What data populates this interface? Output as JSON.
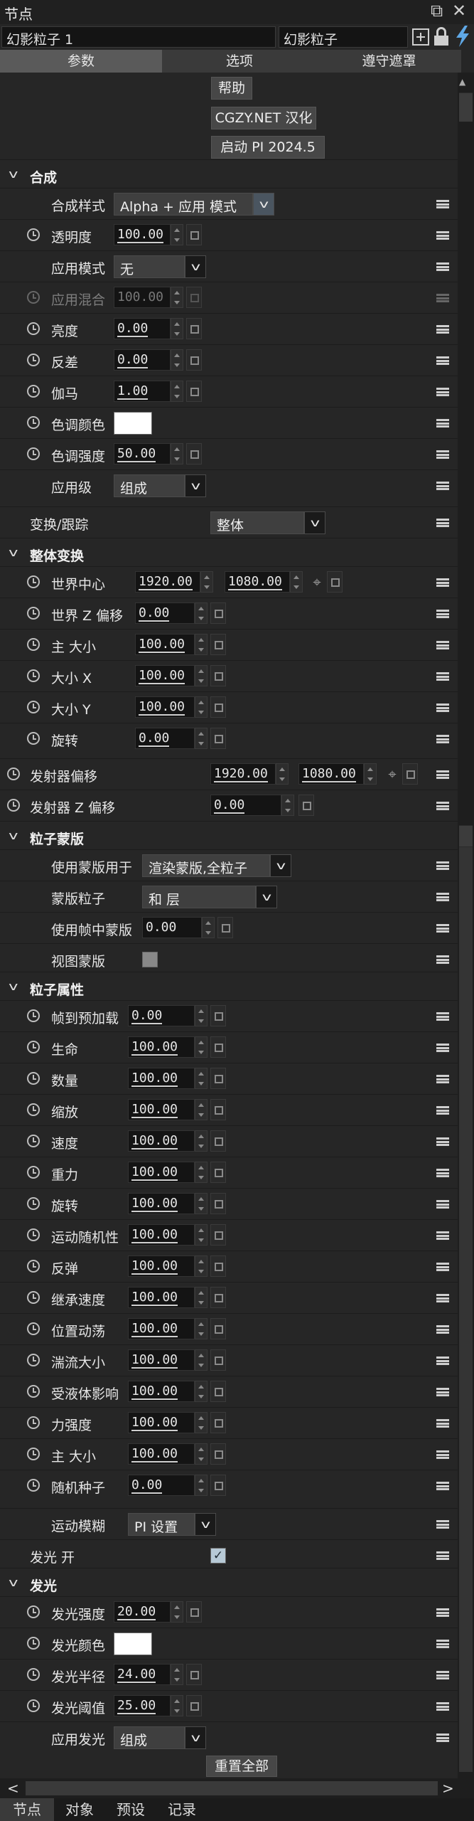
{
  "panel": {
    "title": "节点",
    "dock_icon": "⧉",
    "close_icon": "✕",
    "layer_name": "幻影粒子 1",
    "effect_name": "幻影粒子"
  },
  "tabs": [
    "参数",
    "选项",
    "遵守遮罩"
  ],
  "top_buttons": {
    "help": "帮助",
    "credit": "CGZY.NET 汉化",
    "launch": "启动 PI 2024.5"
  },
  "composite": {
    "header": "合成",
    "style_label": "合成样式",
    "style_value": "Alpha + 应用 模式",
    "opacity_label": "透明度",
    "opacity_value": "100.00",
    "apply_mode_label": "应用模式",
    "apply_mode_value": "无",
    "apply_blend_label": "应用混合",
    "apply_blend_value": "100.00",
    "brightness_label": "亮度",
    "brightness_value": "0.00",
    "contrast_label": "反差",
    "contrast_value": "0.00",
    "gamma_label": "伽马",
    "gamma_value": "1.00",
    "tint_color_label": "色调颜色",
    "tint_color": "#ffffff",
    "tint_strength_label": "色调强度",
    "tint_strength_value": "50.00",
    "apply_level_label": "应用级",
    "apply_level_value": "组成"
  },
  "transform_track": {
    "label": "变换/跟踪",
    "value": "整体"
  },
  "global_transform": {
    "header": "整体变换",
    "world_center_label": "世界中心",
    "world_center_x": "1920.00",
    "world_center_y": "1080.00",
    "world_z_label": "世界 Z 偏移",
    "world_z_value": "0.00",
    "master_size_label": "主 大小",
    "master_size_value": "100.00",
    "size_x_label": "大小 X",
    "size_x_value": "100.00",
    "size_y_label": "大小 Y",
    "size_y_value": "100.00",
    "rotation_label": "旋转",
    "rotation_value": "0.00"
  },
  "emitter": {
    "offset_label": "发射器偏移",
    "offset_x": "1920.00",
    "offset_y": "1080.00",
    "z_offset_label": "发射器 Z 偏移",
    "z_offset_value": "0.00"
  },
  "particle_mask": {
    "header": "粒子蒙版",
    "use_mask_label": "使用蒙版用于",
    "use_mask_value": "渲染蒙版,全粒子",
    "mask_particles_label": "蒙版粒子",
    "mask_particles_value": "和 层",
    "use_frame_mask_label": "使用帧中蒙版",
    "use_frame_mask_value": "0.00",
    "view_mask_label": "视图蒙版"
  },
  "particle_props": {
    "header": "粒子属性",
    "items": [
      {
        "label": "帧到预加载",
        "value": "0.00"
      },
      {
        "label": "生命",
        "value": "100.00"
      },
      {
        "label": "数量",
        "value": "100.00"
      },
      {
        "label": "缩放",
        "value": "100.00"
      },
      {
        "label": "速度",
        "value": "100.00"
      },
      {
        "label": "重力",
        "value": "100.00"
      },
      {
        "label": "旋转",
        "value": "100.00"
      },
      {
        "label": "运动随机性",
        "value": "100.00"
      },
      {
        "label": "反弹",
        "value": "100.00"
      },
      {
        "label": "继承速度",
        "value": "100.00"
      },
      {
        "label": "位置动荡",
        "value": "100.00"
      },
      {
        "label": "湍流大小",
        "value": "100.00"
      },
      {
        "label": "受液体影响",
        "value": "100.00"
      },
      {
        "label": "力强度",
        "value": "100.00"
      },
      {
        "label": "主 大小",
        "value": "100.00"
      },
      {
        "label": "随机种子",
        "value": "0.00"
      }
    ],
    "motion_blur_label": "运动模糊",
    "motion_blur_value": "PI 设置"
  },
  "glow_on": {
    "label": "发光 开",
    "check": "✓"
  },
  "glow": {
    "header": "发光",
    "strength_label": "发光强度",
    "strength_value": "20.00",
    "color_label": "发光颜色",
    "color": "#ffffff",
    "radius_label": "发光半径",
    "radius_value": "24.00",
    "threshold_label": "发光阈值",
    "threshold_value": "25.00",
    "apply_label": "应用发光",
    "apply_value": "组成"
  },
  "reset_all": "重置全部",
  "bottom_tabs": [
    "节点",
    "对象",
    "预设",
    "记录"
  ]
}
